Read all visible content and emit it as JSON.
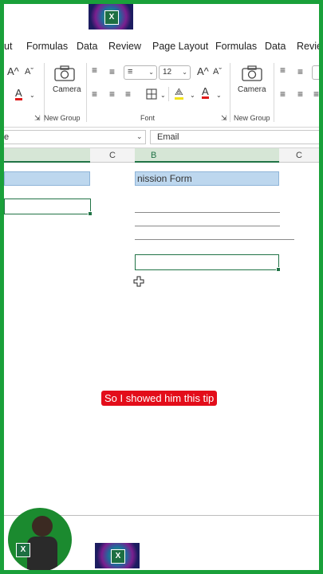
{
  "menu": [
    "ut",
    "Formulas",
    "Data",
    "Review",
    "Page Layout",
    "Formulas",
    "Data",
    "Revie"
  ],
  "ribbon": {
    "font_size_left": "12",
    "camera_label_left": "Camera",
    "camera_label_right": "Camera",
    "group_new_left": "New Group",
    "group_font": "Font",
    "group_new_right": "New Group",
    "font_grow": "A^",
    "font_shrink": "Aˇ"
  },
  "formula_bar": {
    "name_box_value": "e",
    "formula_value": "Email"
  },
  "columns": {
    "left_c": "C",
    "b": "B",
    "right_c": "C"
  },
  "sheet": {
    "title_cell": "nission Form"
  },
  "caption": "So I showed him this tip",
  "colors": {
    "frame": "#1aa03a",
    "excel_green": "#217346",
    "title_fill": "#bdd7ee",
    "caption_red": "#e30d1a"
  },
  "icons": [
    "camera-icon",
    "align-icon",
    "borders-icon",
    "fill-color-icon",
    "font-color-icon",
    "dialog-launcher-icon",
    "move-cursor-icon"
  ]
}
